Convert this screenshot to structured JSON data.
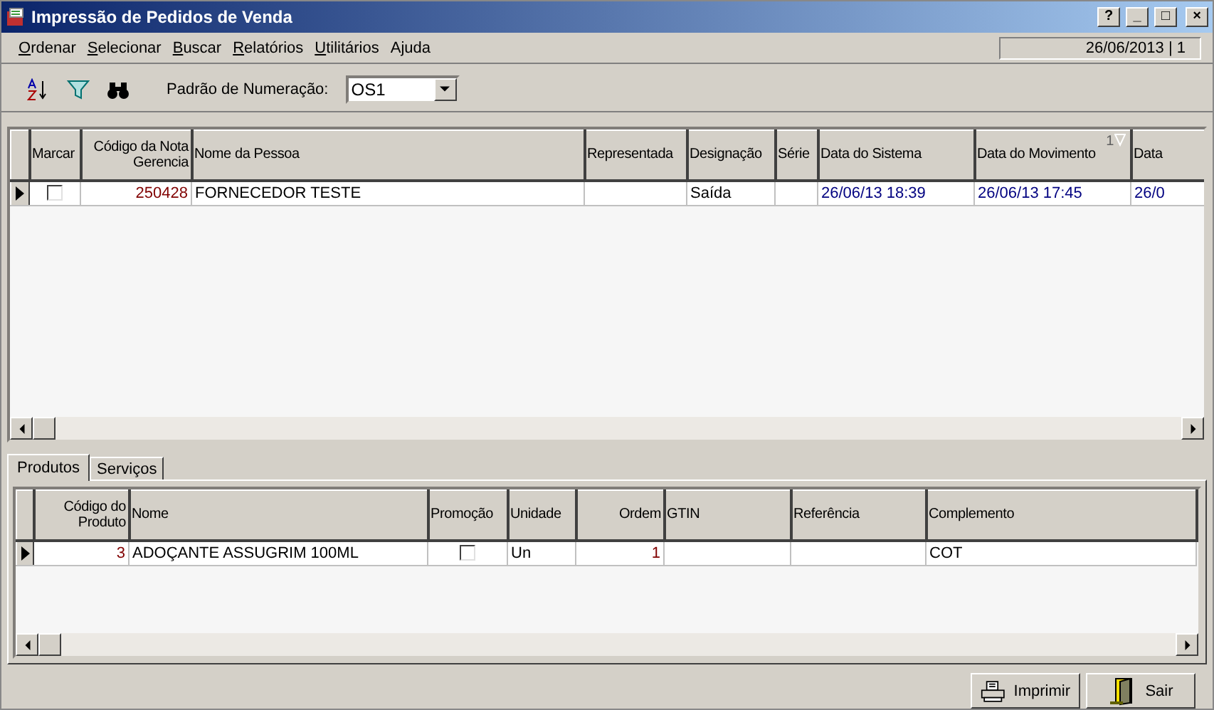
{
  "window": {
    "title": "Impressão de Pedidos de Venda",
    "controls": [
      "?",
      "_",
      "□",
      "×"
    ]
  },
  "menu": [
    {
      "label": "Ordenar",
      "accelerator": true
    },
    {
      "label": "Selecionar",
      "accelerator": true
    },
    {
      "label": "Buscar",
      "accelerator": true
    },
    {
      "label": "Relatórios",
      "accelerator": true
    },
    {
      "label": "Utilitários",
      "accelerator": true
    },
    {
      "label": "Ajuda",
      "accelerator": false
    }
  ],
  "status": "26/06/2013 | 1",
  "toolbar": {
    "numbering_label": "Padrão de Numeração:",
    "numbering_value": "OS1"
  },
  "orders": {
    "columns": [
      {
        "label": "Marcar",
        "kind": "check"
      },
      {
        "label": "Código da Nota Gerencia",
        "kind": "number"
      },
      {
        "label": "Nome da Pessoa",
        "kind": "text"
      },
      {
        "label": "Representada",
        "kind": "text"
      },
      {
        "label": "Designação",
        "kind": "text"
      },
      {
        "label": "Série",
        "kind": "text"
      },
      {
        "label": "Data do Sistema",
        "kind": "date"
      },
      {
        "label": "Data do Movimento",
        "kind": "date",
        "sort_rank": "1"
      },
      {
        "label": "Data",
        "kind": "date"
      }
    ],
    "rows": [
      {
        "current": true,
        "checked": false,
        "cells": [
          "",
          "250428",
          "FORNECEDOR TESTE",
          "",
          "Saída",
          "",
          "26/06/13 18:39",
          "26/06/13 17:45",
          "26/0"
        ]
      }
    ]
  },
  "tabs": [
    {
      "label": "Produtos",
      "selected": true
    },
    {
      "label": "Serviços",
      "selected": false
    }
  ],
  "products": {
    "columns": [
      {
        "label": "Código do Produto",
        "kind": "number"
      },
      {
        "label": "Nome",
        "kind": "text"
      },
      {
        "label": "Promoção",
        "kind": "check"
      },
      {
        "label": "Unidade",
        "kind": "text"
      },
      {
        "label": "Ordem",
        "kind": "number"
      },
      {
        "label": "GTIN",
        "kind": "text"
      },
      {
        "label": "Referência",
        "kind": "text"
      },
      {
        "label": "Complemento",
        "kind": "text"
      }
    ],
    "rows": [
      {
        "current": true,
        "checked": false,
        "cells": [
          "3",
          "ADOÇANTE ASSUGRIM 100ML",
          "",
          "Un",
          "1",
          "",
          "",
          "COT"
        ]
      }
    ]
  },
  "buttons": [
    {
      "label": "Imprimir",
      "kind": "print"
    },
    {
      "label": "Sair",
      "kind": "exit"
    }
  ]
}
